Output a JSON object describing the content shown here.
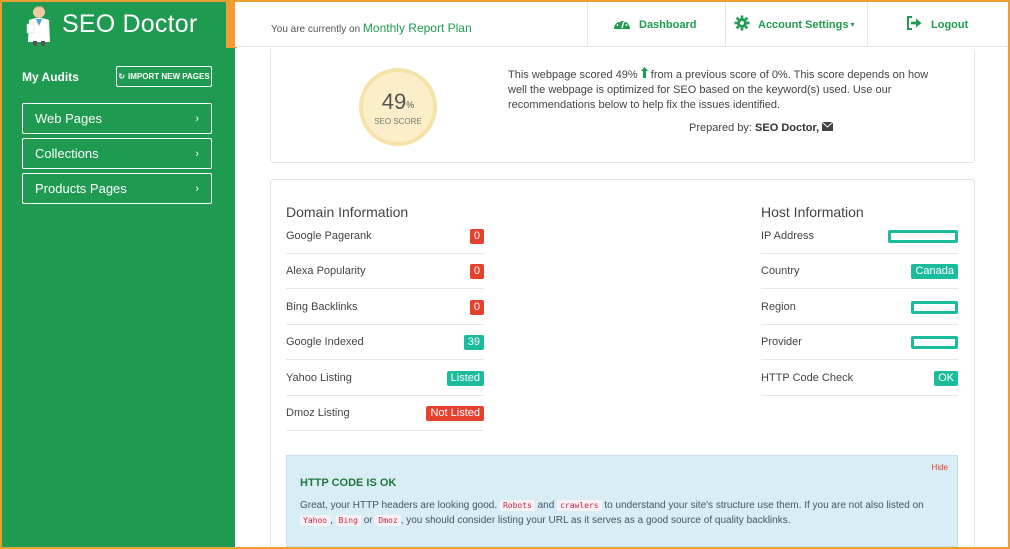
{
  "brand": {
    "name": "SEO Doctor"
  },
  "sidebar": {
    "my_audits_label": "My Audits",
    "import_button_label": "IMPORT NEW PAGES",
    "items": [
      {
        "label": "Web Pages"
      },
      {
        "label": "Collections"
      },
      {
        "label": "Products Pages"
      }
    ]
  },
  "topbar": {
    "plan_prefix": "You are currently on",
    "plan_name": "Monthly Report Plan",
    "dashboard_label": "Dashboard",
    "account_settings_label": "Account Settings",
    "logout_label": "Logout"
  },
  "score": {
    "value": "49",
    "unit": "%",
    "label": "SEO SCORE",
    "description_before": "This webpage scored 49%",
    "description_after": "from a previous score of 0%. This score depends on how well the webpage is optimized for SEO based on the keyword(s) used. Use our recommendations below to help fix the issues identified.",
    "prepared_by_label": "Prepared by:",
    "prepared_by_name": "SEO Doctor,"
  },
  "domain": {
    "title": "Domain Information",
    "rows": [
      {
        "label": "Google Pagerank",
        "value": "0",
        "color": "#e5412d"
      },
      {
        "label": "Alexa Popularity",
        "value": "0",
        "color": "#e5412d"
      },
      {
        "label": "Bing Backlinks",
        "value": "0",
        "color": "#e5412d"
      },
      {
        "label": "Google Indexed",
        "value": "39",
        "color": "#1abc9c"
      },
      {
        "label": "Yahoo Listing",
        "value": "Listed",
        "color": "#1abc9c"
      },
      {
        "label": "Dmoz Listing",
        "value": "Not Listed",
        "color": "#e5412d"
      }
    ]
  },
  "host": {
    "title": "Host Information",
    "rows": [
      {
        "label": "IP Address",
        "value": ""
      },
      {
        "label": "Country",
        "value": "Canada"
      },
      {
        "label": "Region",
        "value": ""
      },
      {
        "label": "Provider",
        "value": ""
      },
      {
        "label": "HTTP Code Check",
        "value": "OK"
      }
    ]
  },
  "alert": {
    "title": "HTTP CODE IS OK",
    "hide_label": "Hide",
    "text_1": "Great, your HTTP headers are looking good.",
    "code_robots": "Robots",
    "text_and": "and",
    "code_crawlers": "crawlers",
    "text_2": "to understand your site's structure use them. If you are not also listed on",
    "code_yahoo": "Yahoo",
    "text_comma": ",",
    "code_bing": "Bing",
    "text_or": "or",
    "code_dmoz": "Dmoz",
    "text_3": ", you should consider listing your URL as it serves as a good source of quality backlinks."
  },
  "colors": {
    "brand_green": "#1e9b50",
    "accent_orange": "#f39c33",
    "teal": "#1abc9c",
    "red": "#e5412d"
  }
}
